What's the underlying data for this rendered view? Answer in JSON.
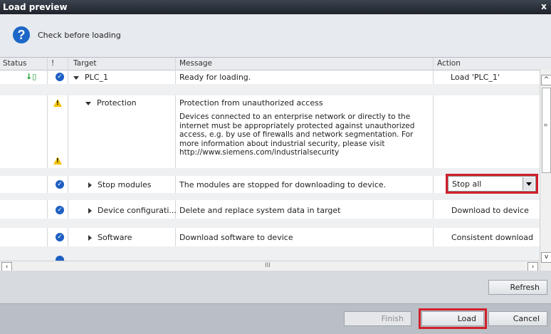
{
  "window": {
    "title": "Load preview",
    "close_glyph": "x"
  },
  "header": {
    "text": "Check before loading",
    "icon": "question-icon"
  },
  "columns": {
    "status": "Status",
    "flag": "!",
    "target": "Target",
    "message": "Message",
    "action": "Action"
  },
  "rows": [
    {
      "target": "PLC_1",
      "message": "Ready for loading.",
      "action": "Load 'PLC_1'"
    },
    {
      "target": "Protection",
      "message": "Protection from unauthorized access"
    },
    {
      "message_lines": [
        "Devices connected to an enterprise network or directly to the",
        "internet must be appropriately protected against unauthorized",
        "access, e.g. by use of firewalls and network segmentation. For",
        "more information about industrial security, please visit",
        "http://www.siemens.com/industrialsecurity"
      ]
    },
    {
      "target": "Stop modules",
      "message": "The modules are stopped for downloading to device.",
      "action": "Stop all"
    },
    {
      "target": "Device configurati...",
      "message": "Delete and replace system data in target",
      "action": "Download to device"
    },
    {
      "target": "Software",
      "message": "Download software to device",
      "action": "Consistent download"
    }
  ],
  "hscroll_thumb": "III",
  "buttons": {
    "refresh": "Refresh",
    "finish": "Finish",
    "load": "Load",
    "cancel": "Cancel"
  },
  "colors": {
    "highlight": "#d12029",
    "check": "#1d5fc2",
    "warning": "#f2c200"
  }
}
